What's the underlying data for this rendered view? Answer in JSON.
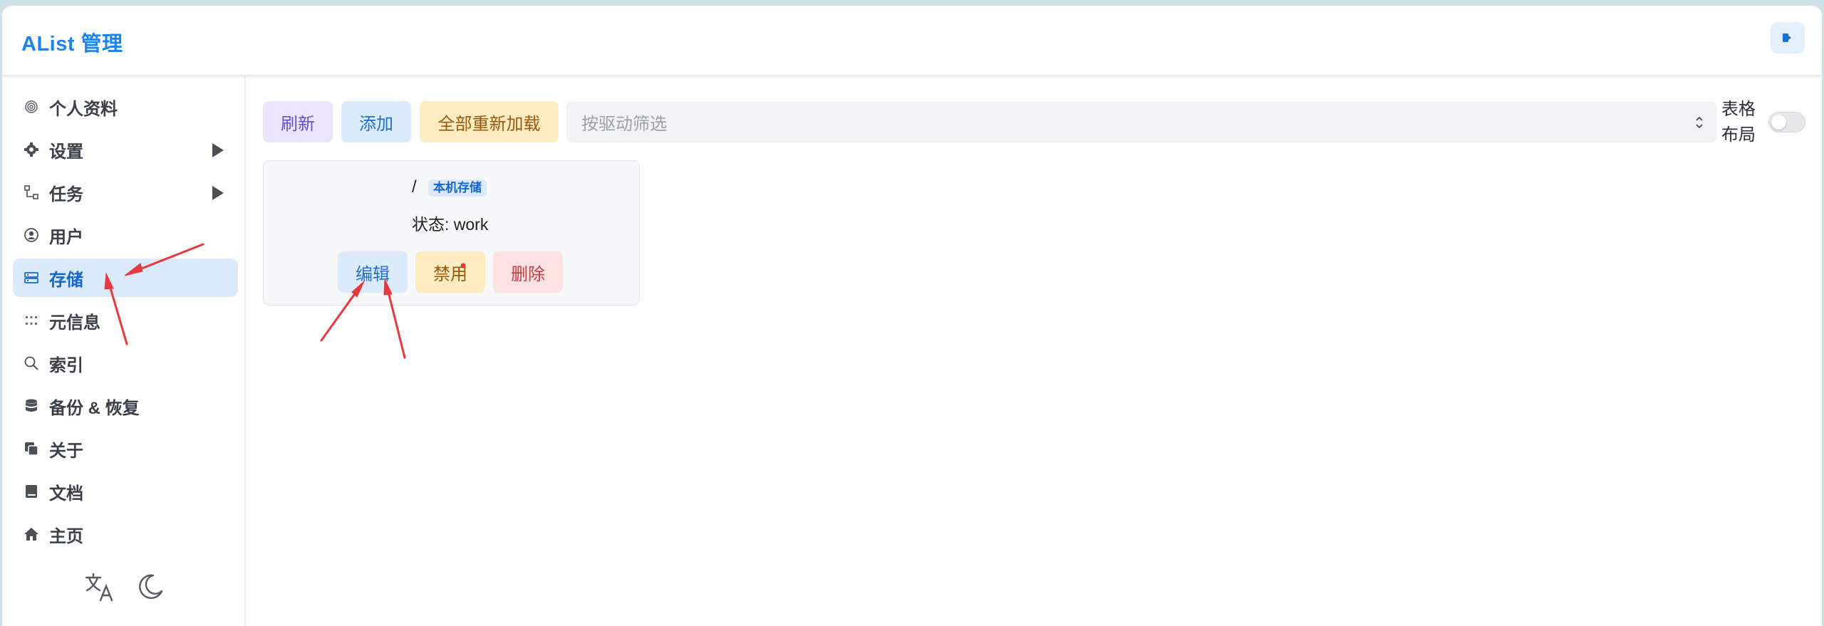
{
  "header": {
    "title": "AList 管理",
    "logout_icon": "logout-icon"
  },
  "sidebar": {
    "items": [
      {
        "label": "个人资料",
        "icon": "fingerprint-icon"
      },
      {
        "label": "设置",
        "icon": "gear-icon",
        "has_submenu": true
      },
      {
        "label": "任务",
        "icon": "tasks-icon",
        "has_submenu": true
      },
      {
        "label": "用户",
        "icon": "user-icon"
      },
      {
        "label": "存储",
        "icon": "storage-icon",
        "active": true
      },
      {
        "label": "元信息",
        "icon": "meta-icon"
      },
      {
        "label": "索引",
        "icon": "search-icon"
      },
      {
        "label": "备份 & 恢复",
        "icon": "database-icon"
      },
      {
        "label": "关于",
        "icon": "copy-icon"
      },
      {
        "label": "文档",
        "icon": "book-icon"
      },
      {
        "label": "主页",
        "icon": "home-icon"
      }
    ],
    "bottom": {
      "language_icon": "translate-icon",
      "theme_icon": "moon-icon"
    }
  },
  "toolbar": {
    "refresh_label": "刷新",
    "add_label": "添加",
    "reload_all_label": "全部重新加载",
    "filter_placeholder": "按驱动筛选",
    "layout_toggle_label": "表格布局",
    "layout_toggle_on": false
  },
  "storages": [
    {
      "mount_path": "/",
      "driver": "本机存储",
      "status": "状态: work",
      "edit_label": "编辑",
      "disable_label": "禁用",
      "delete_label": "删除"
    }
  ],
  "colors": {
    "brand": "#1a85f0",
    "active_bg": "#dbeafb",
    "annotation_arrow": "#e8383d"
  }
}
